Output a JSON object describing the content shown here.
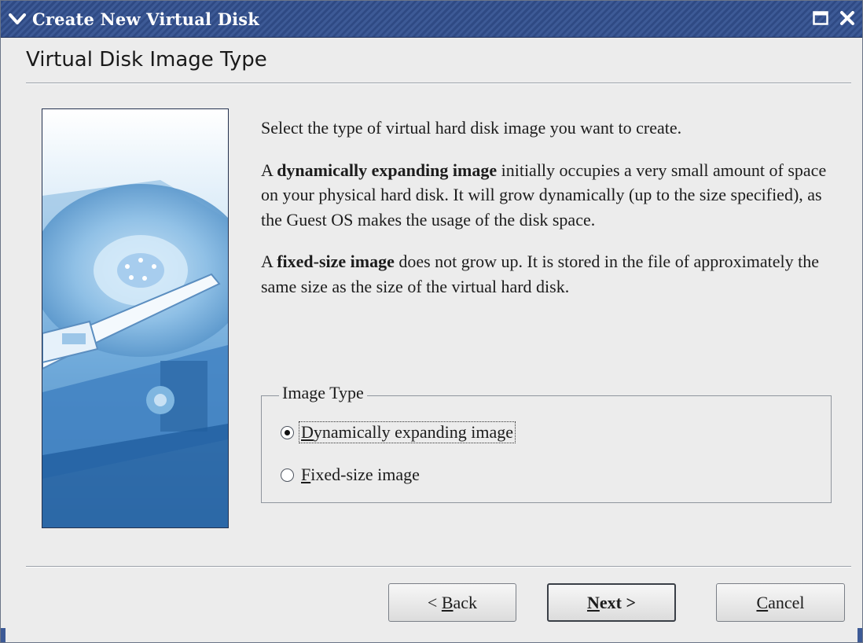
{
  "window": {
    "title": "Create New Virtual Disk",
    "icons": {
      "menu": "chevron-down-icon",
      "maximize": "maximize-icon",
      "close": "close-icon"
    }
  },
  "page": {
    "title": "Virtual Disk Image Type"
  },
  "content": {
    "intro": "Select the type of virtual hard disk image you want to create.",
    "dynamic_prefix": "A ",
    "dynamic_bold": "dynamically expanding image",
    "dynamic_rest": " initially occupies a very small amount of space on your physical hard disk. It will grow dynamically (up to the size specified), as the Guest OS makes the usage of the disk space.",
    "fixed_prefix": "A ",
    "fixed_bold": "fixed-size image",
    "fixed_rest": " does not grow up. It is stored in the file of approximately the same size as the size of the virtual hard disk."
  },
  "image_type": {
    "legend": "Image Type",
    "options": [
      {
        "mnemonic": "D",
        "rest": "ynamically expanding image",
        "checked": true
      },
      {
        "mnemonic": "F",
        "rest": "ixed-size image",
        "checked": false
      }
    ]
  },
  "buttons": {
    "back": {
      "arrow": "<",
      "mnemonic": "B",
      "rest": "ack"
    },
    "next": {
      "mnemonic": "N",
      "rest": "ext",
      "arrow": ">"
    },
    "cancel": {
      "mnemonic": "C",
      "rest": "ancel"
    }
  },
  "colors": {
    "titlebar": "#2f4a84",
    "dialog_bg": "#ececec",
    "image_blue": "#3b78b8"
  }
}
